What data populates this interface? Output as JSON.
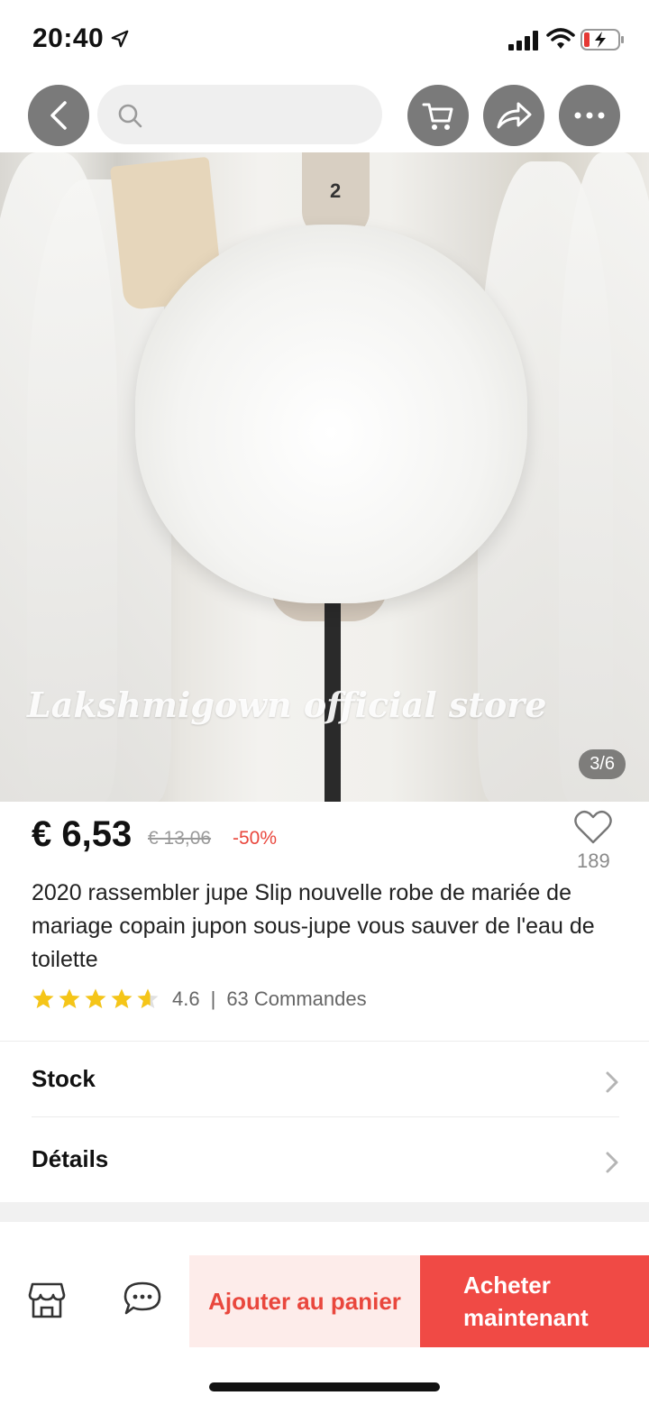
{
  "status": {
    "time": "20:40"
  },
  "search": {
    "placeholder": ""
  },
  "image": {
    "watermark": "Lakshmigown official store",
    "pager": "3/6",
    "mannequin_number": "2"
  },
  "product": {
    "price": "€ 6,53",
    "original_price": "€ 13,06",
    "discount": "-50%",
    "wishlist_count": "189",
    "title": "2020 rassembler jupe Slip nouvelle robe de mariée de mariage copain jupon sous-jupe vous sauver de l'eau de toilette",
    "rating": "4.6",
    "stars": 4.6,
    "orders": "63 Commandes"
  },
  "sections": {
    "stock": "Stock",
    "details": "Détails"
  },
  "bottom": {
    "add_to_cart": "Ajouter au panier",
    "buy_now_line1": "Acheter",
    "buy_now_line2": "maintenant"
  },
  "colors": {
    "accent": "#f04a45",
    "accent_light": "#fdecea",
    "star": "#f5c518"
  },
  "icons": [
    "location-arrow-icon",
    "signal-icon",
    "wifi-icon",
    "battery-icon",
    "back-icon",
    "search-icon",
    "cart-icon",
    "share-icon",
    "more-icon",
    "heart-icon",
    "star-icon",
    "chevron-right-icon",
    "store-icon",
    "chat-icon"
  ]
}
